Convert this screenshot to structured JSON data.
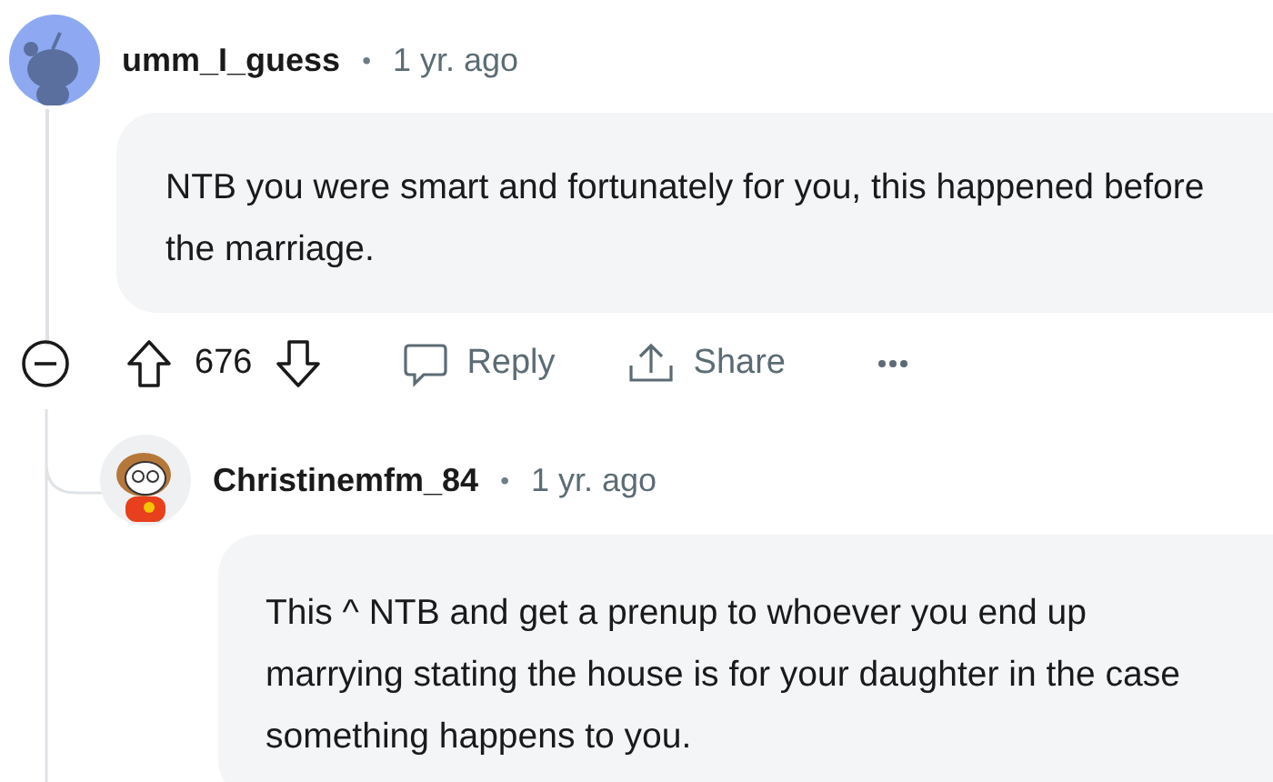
{
  "comments": [
    {
      "author": "umm_I_guess",
      "separator": "•",
      "time": "1 yr. ago",
      "body": "NTB you were smart and fortunately for you, this happened before the marriage.",
      "actions": {
        "score": "676",
        "reply": "Reply",
        "share": "Share"
      }
    },
    {
      "author": "Christinemfm_84",
      "separator": "•",
      "time": "1 yr. ago",
      "body": "This ^ NTB and get a prenup to whoever you end up marrying stating the house is for your daughter in the case something happens to you."
    }
  ]
}
